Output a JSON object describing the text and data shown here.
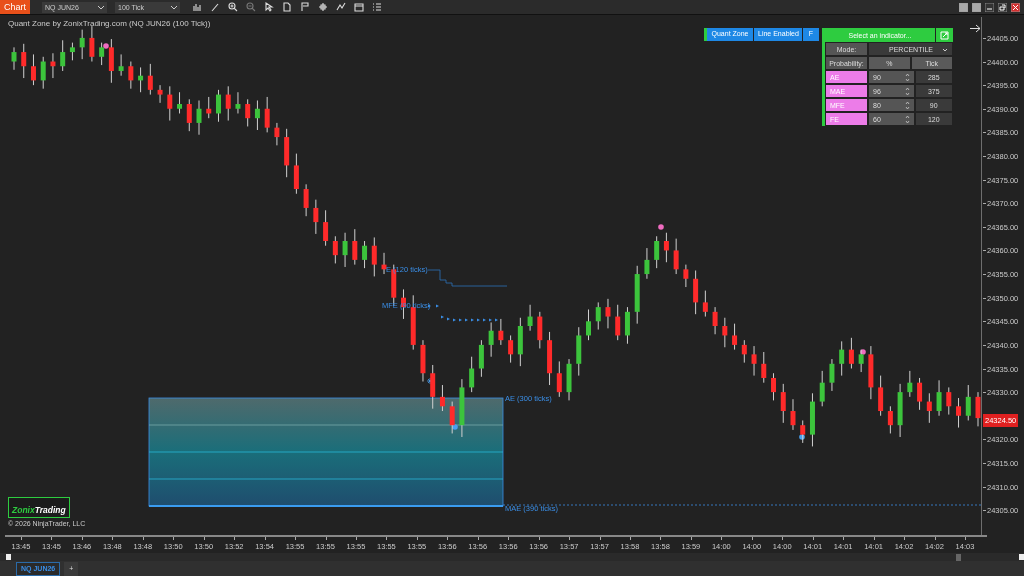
{
  "toolbar": {
    "chart_button": "Chart",
    "instrument": "NQ JUN26",
    "interval": "100 Tick"
  },
  "chart_title": "Quant Zone by ZonixTrading.com (NQ JUN26 (100 Tick))",
  "indicator_buttons": [
    "Quant Zone",
    "Line Enabled",
    "F"
  ],
  "panel": {
    "select_button": "Select an indicator...",
    "mode_label": "Mode:",
    "mode_value": "PERCENTILE",
    "probability_label": "Probability:",
    "columns": [
      "%",
      "Tick"
    ],
    "rows": [
      {
        "name": "AE",
        "percent": "90",
        "tick": "285"
      },
      {
        "name": "MAE",
        "percent": "96",
        "tick": "375"
      },
      {
        "name": "MFE",
        "percent": "80",
        "tick": "90"
      },
      {
        "name": "FE",
        "percent": "60",
        "tick": "120"
      }
    ]
  },
  "zone_labels": [
    "E (120 ticks)",
    "MFE (90 ticks)",
    "AE (300 ticks)",
    "MAE (390 ticks)"
  ],
  "chart_data": {
    "type": "candlestick",
    "ylim": [
      24299.75,
      24409.85
    ],
    "categories": [
      null,
      null,
      null,
      null,
      null,
      null,
      null,
      null,
      null,
      null,
      null,
      null,
      null,
      null,
      null,
      null,
      null,
      null,
      null,
      null,
      null,
      null,
      null,
      null,
      null,
      null,
      null,
      null,
      null,
      null,
      null,
      null,
      null,
      null,
      null,
      null,
      null,
      null,
      null,
      null,
      null,
      null,
      null,
      null,
      null,
      null,
      null,
      null,
      null,
      null,
      null,
      null,
      null,
      null,
      null,
      null,
      null,
      null,
      null,
      null,
      null,
      null,
      null,
      null,
      null,
      null,
      null,
      null,
      null,
      null,
      null,
      null,
      null,
      null,
      null,
      null,
      null,
      null,
      null,
      null,
      null,
      null,
      null,
      null,
      null,
      null,
      null,
      null,
      null,
      null,
      null,
      null,
      null,
      null,
      null,
      null,
      null,
      null,
      null,
      null
    ],
    "yticks": [
      {
        "value": 24405,
        "label": "24405.00"
      },
      {
        "value": 24400,
        "label": "24400.00"
      },
      {
        "value": 24395,
        "label": "24395.00"
      },
      {
        "value": 24390,
        "label": "24390.00"
      },
      {
        "value": 24385,
        "label": "24385.00"
      },
      {
        "value": 24380,
        "label": "24380.00"
      },
      {
        "value": 24375,
        "label": "24375.00"
      },
      {
        "value": 24370,
        "label": "24370.00"
      },
      {
        "value": 24365,
        "label": "24365.00"
      },
      {
        "value": 24360,
        "label": "24360.00"
      },
      {
        "value": 24355,
        "label": "24355.00"
      },
      {
        "value": 24350,
        "label": "24350.00"
      },
      {
        "value": 24345,
        "label": "24345.00"
      },
      {
        "value": 24340,
        "label": "24340.00"
      },
      {
        "value": 24335,
        "label": "24335.00"
      },
      {
        "value": 24330,
        "label": "24330.00"
      },
      {
        "value": 24320,
        "label": "24320.00"
      },
      {
        "value": 24315,
        "label": "24315.00"
      },
      {
        "value": 24310,
        "label": "24310.00"
      },
      {
        "value": 24305,
        "label": "24305.00"
      }
    ],
    "ohlc": [
      [
        24400,
        24403,
        24398.25,
        24402
      ],
      [
        24402,
        24403.75,
        24396.5,
        24399
      ],
      [
        24399,
        24401.5,
        24395,
        24396
      ],
      [
        24396,
        24401,
        24394.25,
        24400
      ],
      [
        24400,
        24401.75,
        24396.5,
        24399
      ],
      [
        24399,
        24404.5,
        24398,
        24402
      ],
      [
        24402,
        24404,
        24400.25,
        24403
      ],
      [
        24403,
        24406.75,
        24400.5,
        24405
      ],
      [
        24405,
        24407.5,
        24400,
        24401
      ],
      [
        24401,
        24404,
        24399.25,
        24403
      ],
      [
        24403,
        24404.75,
        24395.5,
        24398
      ],
      [
        24398,
        24401.5,
        24397,
        24399
      ],
      [
        24399,
        24400,
        24394.25,
        24396
      ],
      [
        24396,
        24398.75,
        24393.5,
        24397
      ],
      [
        24397,
        24399.5,
        24393,
        24394
      ],
      [
        24394,
        24395,
        24391.25,
        24393
      ],
      [
        24393,
        24394.75,
        24387.5,
        24390
      ],
      [
        24390,
        24393.5,
        24389,
        24391
      ],
      [
        24391,
        24392,
        24385.25,
        24387
      ],
      [
        24387,
        24391.75,
        24384.5,
        24390
      ],
      [
        24390,
        24392.5,
        24388,
        24389
      ],
      [
        24389,
        24394,
        24387.25,
        24393
      ],
      [
        24393,
        24394.75,
        24387.5,
        24390
      ],
      [
        24390,
        24393.5,
        24389,
        24391
      ],
      [
        24391,
        24392,
        24386.25,
        24388
      ],
      [
        24388,
        24391.75,
        24385.5,
        24390
      ],
      [
        24390,
        24392.5,
        24385,
        24386
      ],
      [
        24386,
        24387,
        24382.25,
        24384
      ],
      [
        24384,
        24385.75,
        24375.5,
        24378
      ],
      [
        24378,
        24380.5,
        24372,
        24373
      ],
      [
        24373,
        24374,
        24367.25,
        24369
      ],
      [
        24369,
        24370.75,
        24363.5,
        24366
      ],
      [
        24366,
        24368.5,
        24361,
        24362
      ],
      [
        24362,
        24363,
        24357.25,
        24359
      ],
      [
        24359,
        24363.75,
        24356.5,
        24362
      ],
      [
        24362,
        24364.5,
        24357,
        24358
      ],
      [
        24358,
        24362,
        24356.25,
        24361
      ],
      [
        24361,
        24362.75,
        24354.5,
        24357
      ],
      [
        24357,
        24359.5,
        24355,
        24356
      ],
      [
        24356,
        24357,
        24348.25,
        24350
      ],
      [
        24350,
        24351.75,
        24345.5,
        24348
      ],
      [
        24348,
        24350.5,
        24339,
        24340
      ],
      [
        24340,
        24341,
        24332.25,
        24334
      ],
      [
        24334,
        24335.75,
        24326.5,
        24329
      ],
      [
        24329,
        24331.5,
        24326,
        24327
      ],
      [
        24327,
        24328,
        24321.25,
        24323
      ],
      [
        24323,
        24332.75,
        24320.5,
        24331
      ],
      [
        24331,
        24337.5,
        24330,
        24335
      ],
      [
        24335,
        24341,
        24333.25,
        24340
      ],
      [
        24340,
        24344.75,
        24337.5,
        24343
      ],
      [
        24343,
        24345.5,
        24340,
        24341
      ],
      [
        24341,
        24342,
        24336.25,
        24338
      ],
      [
        24338,
        24345.75,
        24335.5,
        24344
      ],
      [
        24344,
        24348.5,
        24343,
        24346
      ],
      [
        24346,
        24347,
        24339.25,
        24341
      ],
      [
        24341,
        24342.75,
        24331.5,
        24334
      ],
      [
        24334,
        24336.5,
        24329,
        24330
      ],
      [
        24330,
        24337,
        24328.25,
        24336
      ],
      [
        24336,
        24343.75,
        24333.5,
        24342
      ],
      [
        24342,
        24347.5,
        24341,
        24345
      ],
      [
        24345,
        24349,
        24343.25,
        24348
      ],
      [
        24348,
        24349.75,
        24343.5,
        24346
      ],
      [
        24346,
        24348.5,
        24341,
        24342
      ],
      [
        24342,
        24348,
        24340.25,
        24347
      ],
      [
        24347,
        24356.75,
        24344.5,
        24355
      ],
      [
        24355,
        24360.5,
        24354,
        24358
      ],
      [
        24358,
        24363,
        24356.25,
        24362
      ],
      [
        24362,
        24363.75,
        24357.5,
        24360
      ],
      [
        24360,
        24362.5,
        24355,
        24356
      ],
      [
        24356,
        24357,
        24352.25,
        24354
      ],
      [
        24354,
        24355.75,
        24346.5,
        24349
      ],
      [
        24349,
        24351.5,
        24346,
        24347
      ],
      [
        24347,
        24348,
        24342.25,
        24344
      ],
      [
        24344,
        24345.75,
        24339.5,
        24342
      ],
      [
        24342,
        24344.5,
        24339,
        24340
      ],
      [
        24340,
        24341,
        24336.25,
        24338
      ],
      [
        24338,
        24339.75,
        24333.5,
        24336
      ],
      [
        24336,
        24338.5,
        24332,
        24333
      ],
      [
        24333,
        24334,
        24328.25,
        24330
      ],
      [
        24330,
        24331.75,
        24323.5,
        24326
      ],
      [
        24326,
        24328.5,
        24322,
        24323
      ],
      [
        24323,
        24324,
        24319.25,
        24321
      ],
      [
        24321,
        24329.75,
        24318.5,
        24328
      ],
      [
        24328,
        24334.5,
        24327,
        24332
      ],
      [
        24332,
        24337,
        24330.25,
        24336
      ],
      [
        24336,
        24340.75,
        24333.5,
        24339
      ],
      [
        24339,
        24341.5,
        24335,
        24336
      ],
      [
        24336,
        24339,
        24334.25,
        24338
      ],
      [
        24338,
        24339.75,
        24328.5,
        24331
      ],
      [
        24331,
        24333.5,
        24325,
        24326
      ],
      [
        24326,
        24327,
        24321.25,
        24323
      ],
      [
        24323,
        24331.75,
        24320.5,
        24330
      ],
      [
        24330,
        24334.5,
        24329,
        24332
      ],
      [
        24332,
        24333,
        24326.25,
        24328
      ],
      [
        24328,
        24329.75,
        24323.5,
        24326
      ],
      [
        24326,
        24332.5,
        24325,
        24330
      ],
      [
        24330,
        24331,
        24325.25,
        24327
      ],
      [
        24327,
        24328.75,
        24322.5,
        24325
      ],
      [
        24325,
        24331.5,
        24324,
        24329
      ],
      [
        24329,
        24330,
        24322.75,
        24324.5
      ]
    ]
  },
  "current_price": "24324.50",
  "time_axis": [
    "13:45",
    "13:45",
    "13:46",
    "13:48",
    "13:48",
    "13:50",
    "13:50",
    "13:52",
    "13:54",
    "13:55",
    "13:55",
    "13:55",
    "13:55",
    "13:55",
    "13:56",
    "13:56",
    "13:56",
    "13:56",
    "13:57",
    "13:57",
    "13:58",
    "13:58",
    "13:59",
    "14:00",
    "14:00",
    "14:00",
    "14:01",
    "14:01",
    "14:01",
    "14:02",
    "14:02",
    "14:03"
  ],
  "logo": {
    "first": "Zonix",
    "second": "Trading"
  },
  "copyright": "© 2026 NinjaTrader, LLC",
  "tabs": [
    {
      "label": "NQ JUN26",
      "selected": true
    }
  ],
  "add_tab": "+"
}
